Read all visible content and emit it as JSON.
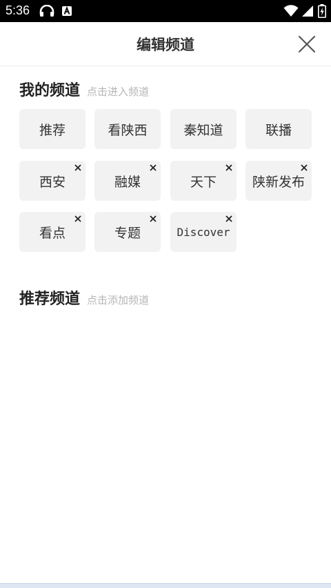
{
  "status_bar": {
    "time": "5:36",
    "icons": [
      "headset-icon",
      "a-notification-icon",
      "wifi-icon",
      "signal-icon",
      "battery-icon"
    ]
  },
  "header": {
    "title": "编辑频道",
    "close_icon": "close-icon"
  },
  "my_channels": {
    "title": "我的频道",
    "hint": "点击进入频道",
    "items": [
      {
        "label": "推荐",
        "removable": false
      },
      {
        "label": "看陕西",
        "removable": false
      },
      {
        "label": "秦知道",
        "removable": false
      },
      {
        "label": "联播",
        "removable": false
      },
      {
        "label": "西安",
        "removable": true
      },
      {
        "label": "融媒",
        "removable": true
      },
      {
        "label": "天下",
        "removable": true
      },
      {
        "label": "陕新发布",
        "removable": true
      },
      {
        "label": "看点",
        "removable": true
      },
      {
        "label": "专题",
        "removable": true
      },
      {
        "label": "Discover",
        "removable": true
      }
    ]
  },
  "recommended_channels": {
    "title": "推荐频道",
    "hint": "点击添加频道",
    "items": []
  }
}
